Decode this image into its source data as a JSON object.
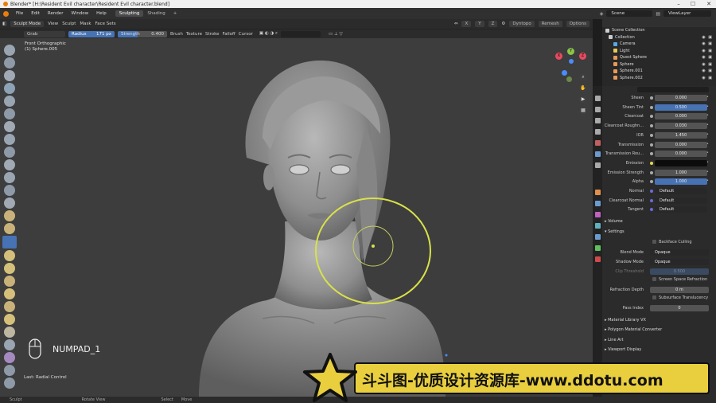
{
  "window": {
    "title": "Blender* [H:\\Resident Evil character\\Resident Evil character.blend]",
    "minimize": "–",
    "maximize": "☐",
    "close": "✕"
  },
  "menu": {
    "items": [
      "File",
      "Edit",
      "Render",
      "Window",
      "Help"
    ],
    "workspaces": [
      "Sculpting",
      "Shading",
      "+"
    ],
    "scene": "Scene",
    "view_layer": "ViewLayer"
  },
  "viewport_header": {
    "mode": "Sculpt Mode",
    "menus": [
      "View",
      "Sculpt",
      "Mask",
      "Face Sets"
    ],
    "axes": [
      "X",
      "Y",
      "Z"
    ],
    "dyntopo": "Dyntopo",
    "remesh": "Remesh",
    "options": "Options"
  },
  "tool_header": {
    "tool": "Grab",
    "radius_label": "Radius",
    "radius_value": "171 px",
    "strength_label": "Strength",
    "strength_value": "0.400",
    "menus": [
      "Brush",
      "Texture",
      "Stroke",
      "Falloff",
      "Cursor"
    ]
  },
  "viewport": {
    "view_name": "Front Orthographic",
    "object_name": "(1) Sphere.005",
    "key_display": "NUMPAD_1",
    "last_op": "Last: Radial Control"
  },
  "gizmo_axes": [
    "Y",
    "X",
    "Z"
  ],
  "outliner": {
    "items": [
      {
        "label": "Scene Collection",
        "color": "#cccccc"
      },
      {
        "label": "Collection",
        "color": "#cccccc"
      },
      {
        "label": "Camera",
        "color": "#58a9e8"
      },
      {
        "label": "Light",
        "color": "#e8c658"
      },
      {
        "label": "Quest Sphere",
        "color": "#e89a58"
      },
      {
        "label": "Sphere",
        "color": "#e89a58"
      },
      {
        "label": "Sphere.001",
        "color": "#e89a58"
      },
      {
        "label": "Sphere.002",
        "color": "#e89a58"
      }
    ]
  },
  "properties": {
    "rows": [
      {
        "label": "Sheen",
        "value": "0.000",
        "style": "gray"
      },
      {
        "label": "Sheen Tint",
        "value": "0.500",
        "style": "blue"
      },
      {
        "label": "Clearcoat",
        "value": "0.000",
        "style": "gray"
      },
      {
        "label": "Clearcoat Roughn...",
        "value": "0.030",
        "style": "gray"
      },
      {
        "label": "IOR",
        "value": "1.450",
        "style": "gray"
      },
      {
        "label": "Transmission",
        "value": "0.000",
        "style": "gray"
      },
      {
        "label": "Transmission Rou...",
        "value": "0.000",
        "style": "gray"
      },
      {
        "label": "Emission",
        "value": "",
        "style": "black"
      },
      {
        "label": "Emission Strength",
        "value": "1.000",
        "style": "gray"
      },
      {
        "label": "Alpha",
        "value": "1.000",
        "style": "blue"
      },
      {
        "label": "Normal",
        "value": "Default",
        "style": "dd"
      },
      {
        "label": "Clearcoat Normal",
        "value": "Default",
        "style": "dd"
      },
      {
        "label": "Tangent",
        "value": "Default",
        "style": "dd"
      }
    ],
    "volume": "Volume",
    "settings": "Settings",
    "backface": "Backface Culling",
    "blend_label": "Blend Mode",
    "blend_value": "Opaque",
    "shadow_label": "Shadow Mode",
    "shadow_value": "Opaque",
    "clip_label": "Clip Threshold",
    "clip_value": "0.500",
    "ssr": "Screen Space Refraction",
    "refr_label": "Refraction Depth",
    "refr_value": "0 m",
    "sss": "Subsurface Translucency",
    "pass_label": "Pass Index",
    "pass_value": "0",
    "panels": [
      "Material Library VX",
      "Polygon Material Converter",
      "Line Art",
      "Viewport Display"
    ]
  },
  "statusbar": {
    "items": [
      "Sculpt",
      "Rotate View",
      "Select",
      "Move"
    ]
  },
  "watermark": {
    "text": "斗斗图-优质设计资源库-www.ddotu.com"
  }
}
